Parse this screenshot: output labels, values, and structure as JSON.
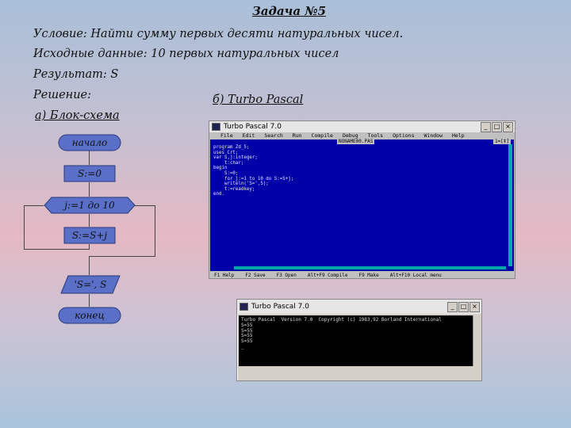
{
  "slide": {
    "title": "Задача №5",
    "condition": "Условие: Найти сумму первых  десяти натуральных чисел.",
    "input_data": "Исходные данные: 10 первых натуральных чисел",
    "result": "Результат: S",
    "solution": "Решение:",
    "part_a": "а) Блок-схема",
    "part_b": "б) Turbo Pascal"
  },
  "flowchart": {
    "start": "начало",
    "init": "S:=0",
    "loop": "j:=1 до 10",
    "body": "S:=S+j",
    "output": "'S=', S",
    "end": "конец"
  },
  "ide": {
    "title": "Turbo Pascal 7.0",
    "menu": [
      "File",
      "Edit",
      "Search",
      "Run",
      "Compile",
      "Debug",
      "Tools",
      "Options",
      "Window",
      "Help"
    ],
    "file_name": "NONAME00.PAS",
    "window_no": "1=[‡]",
    "code": "program Zd_5;\nuses Crt;\nvar S,j:integer;\n    t:char;\nbegin\n    S:=0;\n    for j:=1 to 10 do S:=S+j;\n    writeln('S=',S);\n    t:=readkey;\nend.",
    "status": [
      "F1 Help",
      "F2 Save",
      "F3 Open",
      "Alt+F9 Compile",
      "F9 Make",
      "Alt+F10 Local menu"
    ],
    "controls": {
      "minimize": "_",
      "maximize": "□",
      "close": "×"
    }
  },
  "console": {
    "title": "Turbo Pascal 7.0",
    "output": "Turbo Pascal  Version 7.0  Copyright (c) 1983,92 Borland International\nS=55\nS=55\nS=55\nS=55\n_",
    "controls": {
      "minimize": "_",
      "maximize": "□",
      "close": "×"
    }
  },
  "colors": {
    "editor_bg": "#0000a8",
    "console_bg": "#000000",
    "accent": "#00a8a8"
  }
}
